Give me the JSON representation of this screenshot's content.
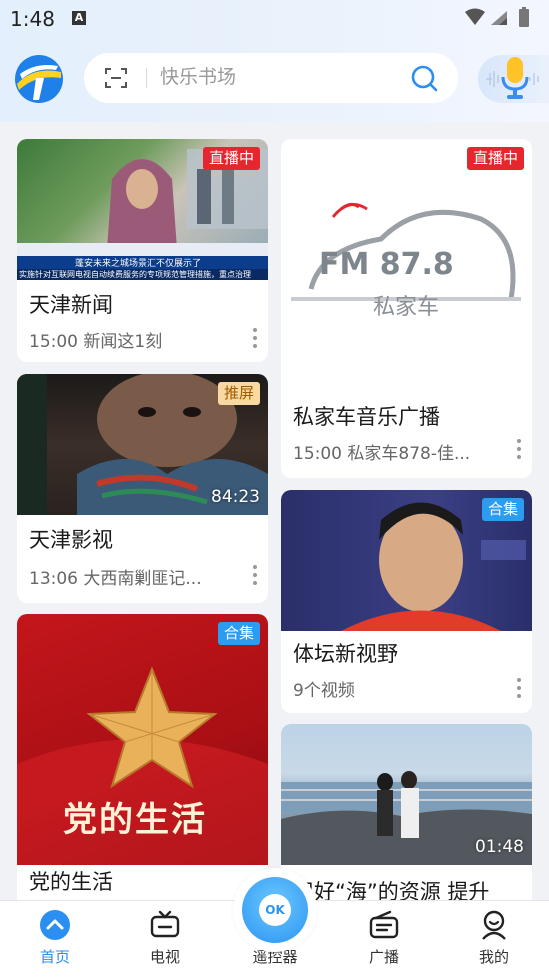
{
  "status_bar": {
    "time": "1:48",
    "notification_letter": "A"
  },
  "search": {
    "placeholder": "快乐书场"
  },
  "cards": [
    {
      "title": "天津新闻",
      "subtitle": "15:00 新闻这1刻",
      "badge": "直播中",
      "ticker": "蓬安未来之城场景汇不仅展示了",
      "ticker2": "实施针对互联网电视自动续费服务的专项规范管理措施，重点治理"
    },
    {
      "title": "私家车音乐广播",
      "subtitle": "15:00 私家车878-佳...",
      "badge": "直播中",
      "fm_text": "FM 87.8",
      "fm_brand": "私家车"
    },
    {
      "title": "天津影视",
      "subtitle": "13:06 大西南剿匪记...",
      "badge": "推屏",
      "duration": "84:23"
    },
    {
      "title": "体坛新视野",
      "subtitle": "9个视频",
      "badge": "合集"
    },
    {
      "title": "党的生活",
      "badge": "合集",
      "art_text": "党的生活"
    },
    {
      "title": "用好“海”的资源 提升",
      "duration": "01:48"
    }
  ],
  "remote": {
    "ok_label": "OK"
  },
  "tabs": [
    {
      "label": "首页",
      "icon": "home-icon",
      "active": true
    },
    {
      "label": "电视",
      "icon": "tv-icon"
    },
    {
      "label": "遥控器",
      "icon": "remote-icon"
    },
    {
      "label": "广播",
      "icon": "radio-icon"
    },
    {
      "label": "我的",
      "icon": "profile-icon"
    }
  ],
  "colors": {
    "accent": "#2a8ff0",
    "live_badge": "#e6262f",
    "collection_badge": "#2c9cf0"
  }
}
